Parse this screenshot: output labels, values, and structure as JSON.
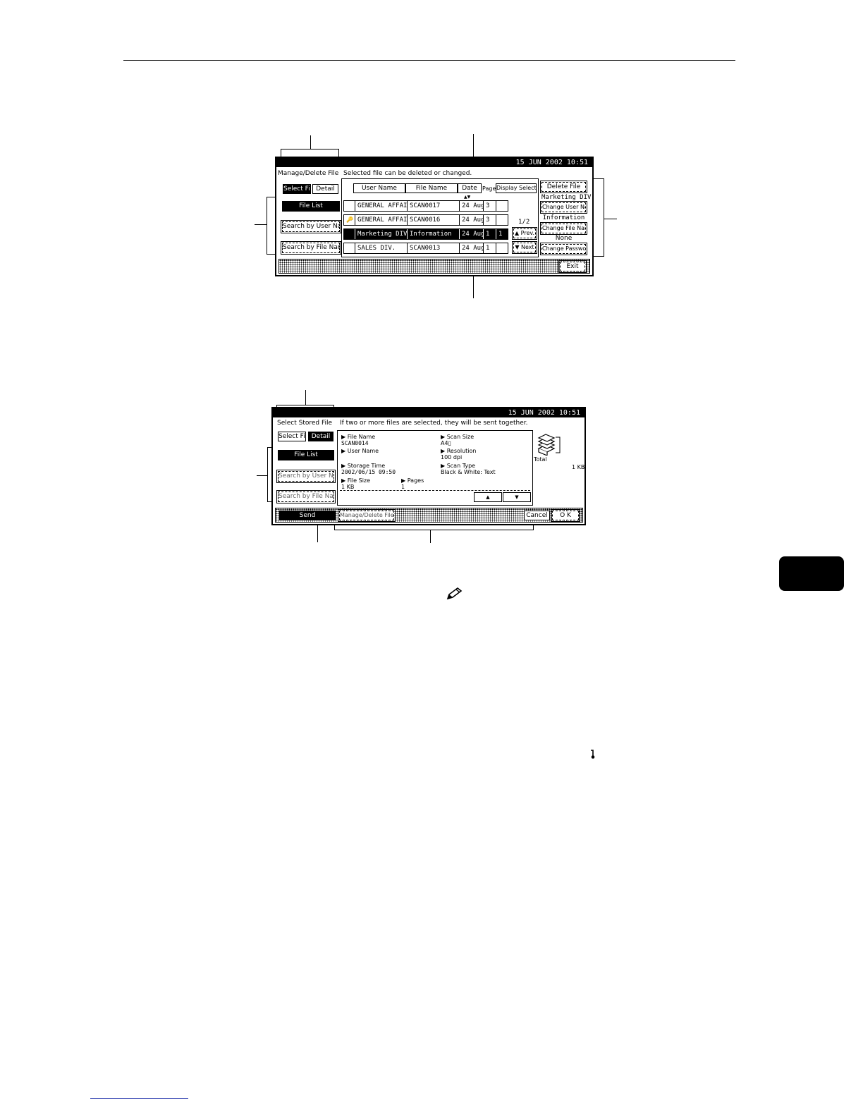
{
  "screen1": {
    "datetime": "15  JUN   2002 10:51",
    "title": "Manage/Delete File",
    "message": "Selected file can be deleted or changed.",
    "tabs": {
      "select_file": "Select File",
      "detail": "Detail"
    },
    "side": {
      "file_list": "File List",
      "search_user": "Search by User Name",
      "search_file": "Search by File Name"
    },
    "headers": {
      "user_name": "User Name",
      "file_name": "File Name",
      "date": "Date",
      "pages": "Pages",
      "display_selection": "Display Selection"
    },
    "sort_arrows": "▲▼",
    "rows": [
      {
        "icon": "",
        "user": "GENERAL AFFAIRS",
        "file": "SCAN0017",
        "date": "24 Aug",
        "pages": "3",
        "extra": ""
      },
      {
        "icon": "🔑",
        "user": "GENERAL AFFAIRS",
        "file": "SCAN0016",
        "date": "24 Aug",
        "pages": "3",
        "extra": ""
      },
      {
        "icon": "",
        "user": "Marketing DIV.",
        "file": "Information",
        "date": "24 Aug",
        "pages": "1",
        "extra": "1"
      },
      {
        "icon": "",
        "user": "SALES DIV.",
        "file": "SCAN0013",
        "date": "24 Aug",
        "pages": "1",
        "extra": ""
      }
    ],
    "page_indicator": "1/2",
    "prev": "▲ Prev.",
    "next": "▼ Next",
    "right": {
      "delete_file": "Delete File",
      "user_value": "Marketing DIV.",
      "change_user": "Change User Name",
      "file_value": "Information",
      "change_file": "Change File Name",
      "password_value": "None",
      "change_password": "Change Password"
    },
    "exit": "Exit"
  },
  "screen2": {
    "datetime": "15  JUN   2002 10:51",
    "title": "Select Stored File",
    "message": "If two or more files are selected, they will be sent together.",
    "tabs": {
      "select_file": "Select File",
      "detail": "Detail"
    },
    "side": {
      "file_list": "File List",
      "search_user": "Search by User Name",
      "search_file": "Search by File Name"
    },
    "details": {
      "file_name_label": "▶ File Name",
      "file_name": "SCAN0014",
      "scan_size_label": "▶ Scan Size",
      "scan_size": "A4▯",
      "user_name_label": "▶ User Name",
      "resolution_label": "▶ Resolution",
      "resolution": "100 dpi",
      "storage_time_label": "▶ Storage Time",
      "storage_time": "2002/06/15 09:50",
      "scan_type_label": "▶ Scan Type",
      "scan_type": "Black & White: Text",
      "file_size_label": "▶ File Size",
      "file_size": "1 KB",
      "pages_label": "▶ Pages",
      "pages": "1"
    },
    "up": "▲",
    "down": "▼",
    "total_label": "Total",
    "total_value": "1 KB",
    "send": "Send",
    "manage": "Manage/Delete File",
    "cancel": "Cancel",
    "ok": "O K"
  },
  "note_icon": "pencil-icon",
  "key_glyph": "🔑"
}
